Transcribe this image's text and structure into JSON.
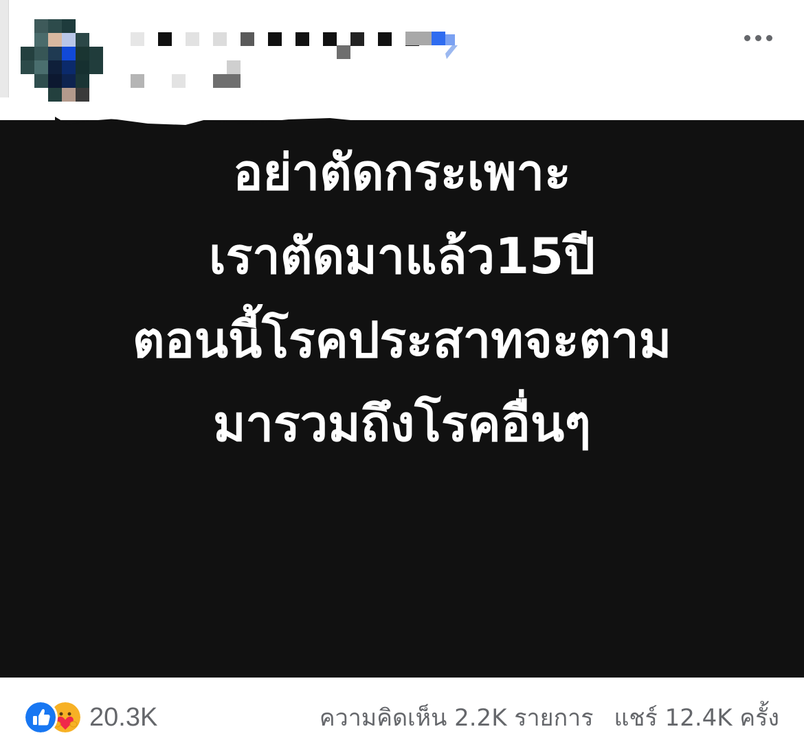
{
  "post": {
    "menu_icon": "more-horizontal-icon",
    "image_text": {
      "lines": [
        "อย่าตัดกระเพาะ",
        "เราตัดมาแล้ว15ปี",
        "ตอนนี้โรคประสาทจะตาม",
        "มารวมถึงโรคอื่นๆ"
      ]
    },
    "footer": {
      "reaction_icons": [
        "like-icon",
        "care-icon"
      ],
      "reaction_count": "20.3K",
      "comments_text": "ความคิดเห็น 2.2K รายการ",
      "shares_text": "แชร์ 12.4K ครั้ง"
    }
  },
  "colors": {
    "image_background": "#111111",
    "image_text": "#ffffff",
    "meta_text": "#65676b",
    "like_blue": "#1877f2",
    "care_yellow": "#f7b125"
  }
}
